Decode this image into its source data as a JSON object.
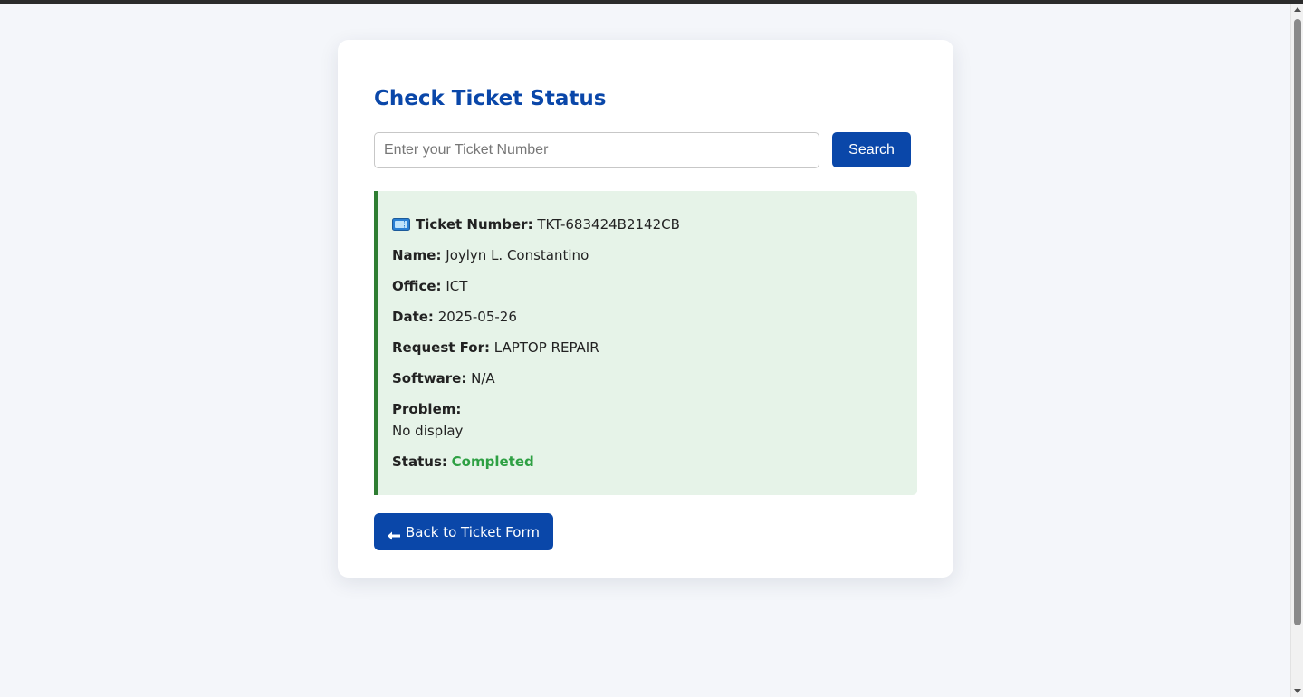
{
  "page": {
    "title": "Check Ticket Status"
  },
  "search": {
    "placeholder": "Enter your Ticket Number",
    "value": "",
    "button_label": "Search"
  },
  "ticket": {
    "icon": "ticket-icon",
    "fields": {
      "ticket_number": {
        "label": "Ticket Number:",
        "value": "TKT-683424B2142CB"
      },
      "name": {
        "label": "Name:",
        "value": "Joylyn L. Constantino"
      },
      "office": {
        "label": "Office:",
        "value": "ICT"
      },
      "date": {
        "label": "Date:",
        "value": "2025-05-26"
      },
      "request_for": {
        "label": "Request For:",
        "value": "LAPTOP REPAIR"
      },
      "software": {
        "label": "Software:",
        "value": "N/A"
      },
      "problem": {
        "label": "Problem:",
        "value": "No display"
      },
      "status": {
        "label": "Status:",
        "value": "Completed"
      }
    }
  },
  "back_button": {
    "icon": "arrow-left-icon",
    "label": "Back to Ticket Form"
  },
  "colors": {
    "primary": "#0a47a9",
    "page_background": "#f4f6fa",
    "result_background": "#e6f3e8",
    "result_border": "#2e7d32",
    "status_completed": "#2ea043"
  }
}
